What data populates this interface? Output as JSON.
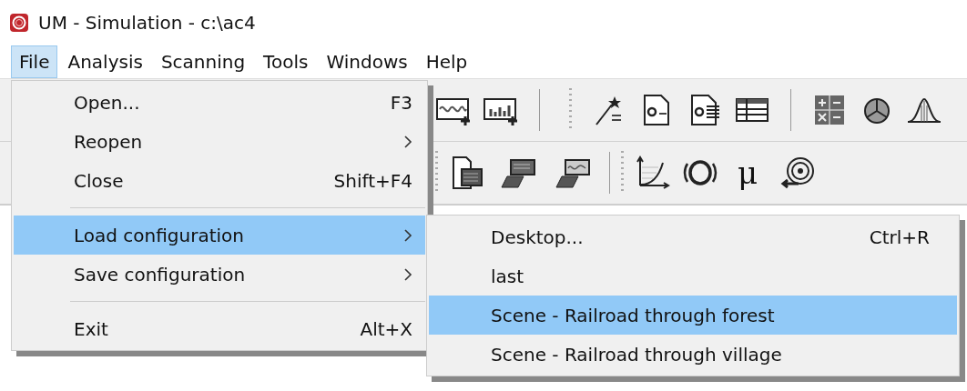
{
  "window": {
    "title": "UM - Simulation - c:\\ac4"
  },
  "menubar": [
    {
      "label": "File",
      "selected": true
    },
    {
      "label": "Analysis",
      "selected": false
    },
    {
      "label": "Scanning",
      "selected": false
    },
    {
      "label": "Tools",
      "selected": false
    },
    {
      "label": "Windows",
      "selected": false
    },
    {
      "label": "Help",
      "selected": false
    }
  ],
  "toolbar": {
    "glyph_button": "μ"
  },
  "file_menu": [
    {
      "kind": "item",
      "label": "Open...",
      "shortcut": "F3",
      "has_submenu": false,
      "selected": false
    },
    {
      "kind": "item",
      "label": "Reopen",
      "has_submenu": true,
      "selected": false
    },
    {
      "kind": "item",
      "label": "Close",
      "shortcut": "Shift+F4",
      "has_submenu": false,
      "selected": false
    },
    {
      "kind": "separator"
    },
    {
      "kind": "item",
      "label": "Load configuration",
      "has_submenu": true,
      "selected": true
    },
    {
      "kind": "item",
      "label": "Save configuration",
      "has_submenu": true,
      "selected": false
    },
    {
      "kind": "separator"
    },
    {
      "kind": "item",
      "label": "Exit",
      "shortcut": "Alt+X",
      "has_submenu": false,
      "selected": false
    }
  ],
  "submenu": [
    {
      "kind": "item",
      "label": "Desktop...",
      "shortcut": "Ctrl+R",
      "has_submenu": false,
      "selected": false
    },
    {
      "kind": "item",
      "label": "last",
      "has_submenu": false,
      "selected": false
    },
    {
      "kind": "item",
      "label": "Scene - Railroad through forest",
      "has_submenu": false,
      "selected": true
    },
    {
      "kind": "item",
      "label": "Scene - Railroad through village",
      "has_submenu": false,
      "selected": false
    }
  ]
}
